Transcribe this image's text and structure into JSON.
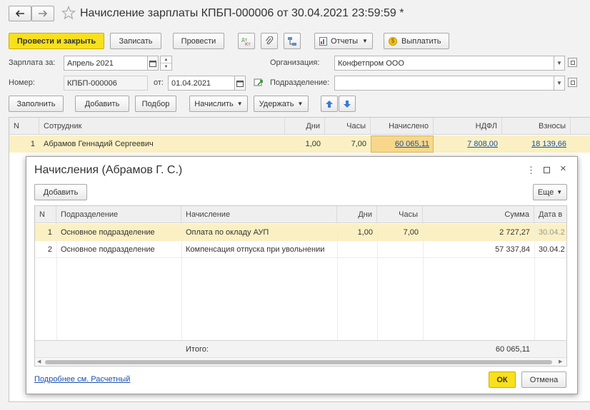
{
  "window": {
    "title": "Начисление зарплаты КПБП-000006 от 30.04.2021 23:59:59 *"
  },
  "toolbar": {
    "post_close": "Провести и закрыть",
    "save": "Записать",
    "post": "Провести",
    "reports": "Отчеты",
    "pay": "Выплатить"
  },
  "form": {
    "salary_for_label": "Зарплата за:",
    "salary_for_value": "Апрель 2021",
    "org_label": "Организация:",
    "org_value": "Конфетпром ООО",
    "number_label": "Номер:",
    "number_value": "КПБП-000006",
    "date_label": "от:",
    "date_value": "01.04.2021",
    "dept_label": "Подразделение:",
    "dept_value": ""
  },
  "actions": {
    "fill": "Заполнить",
    "add": "Добавить",
    "select": "Подбор",
    "accrue": "Начислить",
    "withhold": "Удержать"
  },
  "table": {
    "headers": [
      "N",
      "Сотрудник",
      "Дни",
      "Часы",
      "Начислено",
      "НДФЛ",
      "Взносы"
    ],
    "rows": [
      {
        "n": "1",
        "employee": "Абрамов Геннадий Сергеевич",
        "days": "1,00",
        "hours": "7,00",
        "accrued": "60 065,11",
        "ndfl": "7 808,00",
        "contrib": "18 139,66"
      }
    ]
  },
  "dialog": {
    "title": "Начисления (Абрамов Г. С.)",
    "add": "Добавить",
    "more": "Еще",
    "headers": [
      "N",
      "Подразделение",
      "Начисление",
      "Дни",
      "Часы",
      "Сумма",
      "Дата в"
    ],
    "rows": [
      {
        "n": "1",
        "dept": "Основное подразделение",
        "accrual": "Оплата по окладу АУП",
        "days": "1,00",
        "hours": "7,00",
        "sum": "2 727,27",
        "date": "30.04.2"
      },
      {
        "n": "2",
        "dept": "Основное подразделение",
        "accrual": "Компенсация отпуска при увольнении",
        "days": "",
        "hours": "",
        "sum": "57 337,84",
        "date": "30.04.2"
      }
    ],
    "footer_label": "Итого:",
    "footer_sum": "60 065,11",
    "more_link": "Подробнее см. Расчетный",
    "ok": "ОК",
    "cancel": "Отмена"
  },
  "colors": {
    "primary": "#f8e01c",
    "selected_row": "#fbf0c3",
    "link": "#1b4fad"
  }
}
